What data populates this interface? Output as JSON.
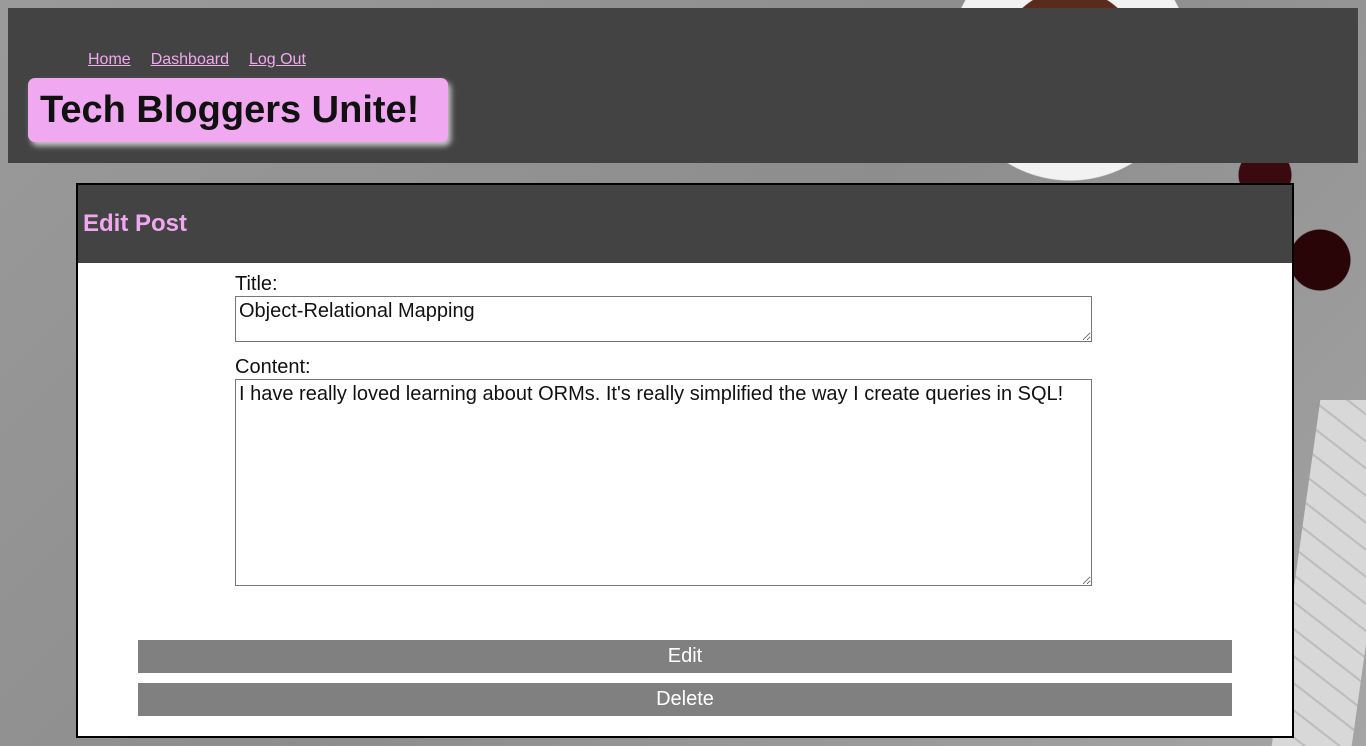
{
  "nav": {
    "items": [
      {
        "label": "Home"
      },
      {
        "label": "Dashboard"
      },
      {
        "label": "Log Out"
      }
    ]
  },
  "site": {
    "title": "Tech Bloggers Unite!"
  },
  "card": {
    "heading": "Edit Post",
    "title_label": "Title:",
    "title_value": "Object-Relational Mapping",
    "content_label": "Content:",
    "content_value": "I have really loved learning about ORMs. It's really simplified the way I create queries in SQL!",
    "edit_label": "Edit",
    "delete_label": "Delete"
  },
  "colors": {
    "accent": "#f0a8f0",
    "header_bg": "#434343",
    "button_bg": "#808080"
  }
}
